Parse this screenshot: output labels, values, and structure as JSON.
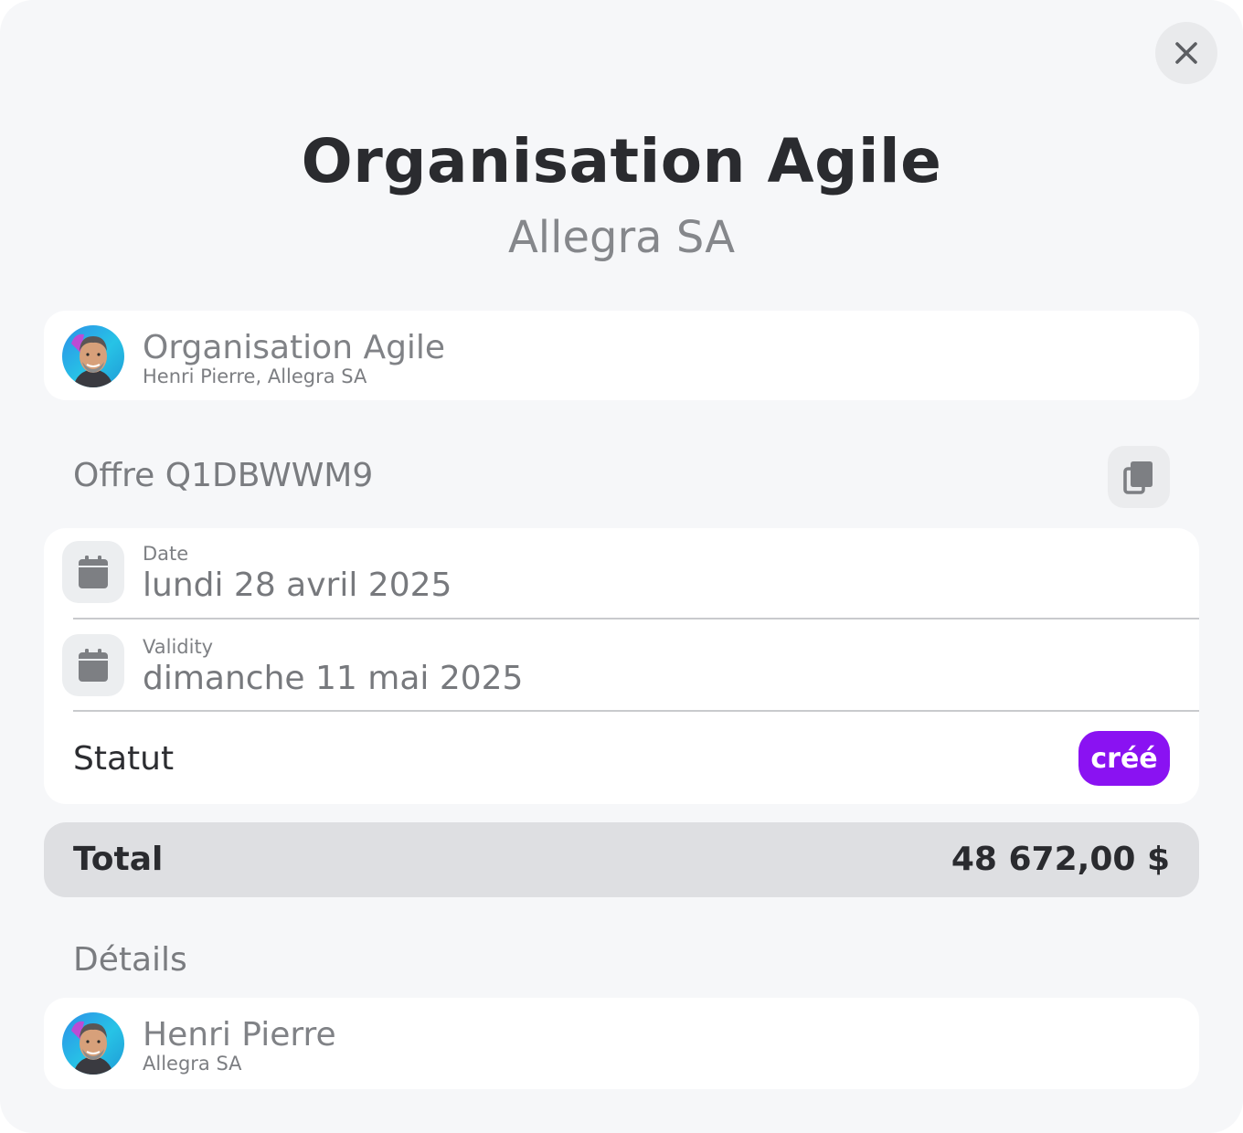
{
  "header": {
    "title": "Organisation Agile",
    "subtitle": "Allegra SA"
  },
  "close_icon": "close-icon",
  "contact_card": {
    "name": "Organisation Agile",
    "subtitle": "Henri Pierre, Allegra SA",
    "avatar": "avatar-photo"
  },
  "offer": {
    "label": "Offre Q1DBWWM9",
    "copy_icon": "copy-icon"
  },
  "dates": [
    {
      "label": "Date",
      "value": "lundi 28 avril 2025",
      "icon": "calendar-icon"
    },
    {
      "label": "Validity",
      "value": "dimanche 11 mai 2025",
      "icon": "calendar-icon"
    }
  ],
  "status": {
    "label": "Statut",
    "value": "créé",
    "color": "#8a12f2"
  },
  "total": {
    "label": "Total",
    "value": "48 672,00 $"
  },
  "details": {
    "title": "Détails",
    "contact": {
      "name": "Henri Pierre",
      "subtitle": "Allegra SA",
      "avatar": "avatar-photo"
    }
  }
}
